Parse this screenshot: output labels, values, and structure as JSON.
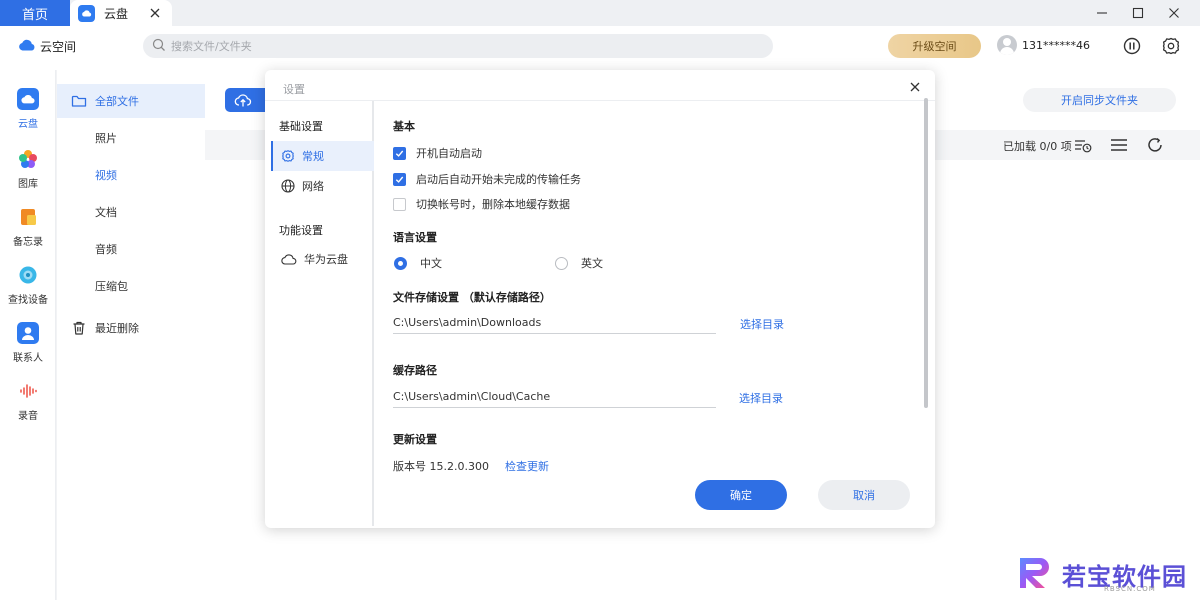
{
  "titlebar": {
    "home_tab": "首页",
    "file_tab": "云盘"
  },
  "toolbar": {
    "brand": "云空间",
    "search_placeholder": "搜索文件/文件夹",
    "upgrade": "升级空间",
    "phone": "131******46"
  },
  "rail": {
    "items": [
      {
        "label": "云盘",
        "icon": "cloud-drive-icon"
      },
      {
        "label": "图库",
        "icon": "gallery-icon"
      },
      {
        "label": "备忘录",
        "icon": "notes-icon"
      },
      {
        "label": "查找设备",
        "icon": "find-device-icon"
      },
      {
        "label": "联系人",
        "icon": "contacts-icon"
      },
      {
        "label": "录音",
        "icon": "recorder-icon"
      }
    ]
  },
  "nav": {
    "all_files": "全部文件",
    "photos": "照片",
    "videos": "视频",
    "documents": "文档",
    "audio": "音频",
    "archives": "压缩包",
    "recently_deleted": "最近删除"
  },
  "main": {
    "sync_folder": "开启同步文件夹",
    "loaded": "已加载 0/0 项"
  },
  "dialog": {
    "title": "设置",
    "nav": {
      "basic_group": "基础设置",
      "general": "常规",
      "network": "网络",
      "feature_group": "功能设置",
      "huawei_cloud": "华为云盘"
    },
    "basic": {
      "heading": "基本",
      "auto_start": "开机自动启动",
      "auto_resume": "启动后自动开始未完成的传输任务",
      "clear_cache": "切换帐号时，删除本地缓存数据"
    },
    "language": {
      "heading": "语言设置",
      "chinese": "中文",
      "english": "英文"
    },
    "storage": {
      "heading": "文件存储设置",
      "heading_note": "（默认存储路径）",
      "path": "C:\\Users\\admin\\Downloads",
      "choose": "选择目录"
    },
    "cache": {
      "heading": "缓存路径",
      "path": "C:\\Users\\admin\\Cloud\\Cache",
      "choose": "选择目录"
    },
    "update": {
      "heading": "更新设置",
      "version": "版本号 15.2.0.300",
      "check": "检查更新"
    },
    "ok": "确定",
    "cancel": "取消"
  },
  "watermark": {
    "text": "若宝软件园",
    "sub": "RBSCN.COM"
  },
  "colors": {
    "accent": "#2f6fe4",
    "upgrade_gold": "#e8c788"
  }
}
